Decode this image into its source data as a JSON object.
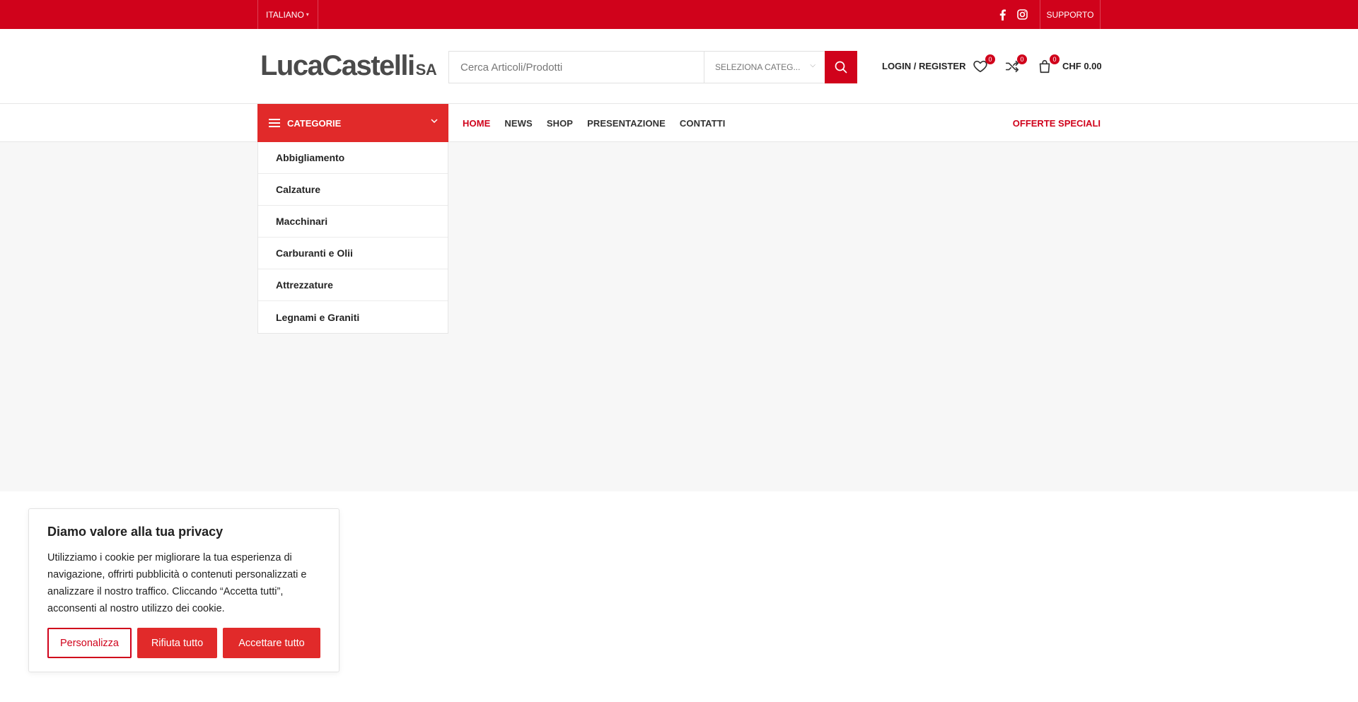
{
  "topbar": {
    "language": "ITALIANO",
    "support": "SUPPORTO",
    "social": [
      "facebook-icon",
      "instagram-icon"
    ]
  },
  "header": {
    "logo_main": "LucaCastelli",
    "logo_suffix": "SA",
    "search_placeholder": "Cerca Articoli/Prodotti",
    "search_category": "SELEZIONA CATEG...",
    "login": "LOGIN / REGISTER",
    "wishlist_count": "0",
    "compare_count": "0",
    "cart_count": "0",
    "cart_total": "CHF 0.00"
  },
  "nav": {
    "categories_label": "CATEGORIE",
    "items": [
      "HOME",
      "NEWS",
      "SHOP",
      "PRESENTAZIONE",
      "CONTATTI"
    ],
    "offers": "OFFERTE SPECIALI"
  },
  "categories": [
    "Abbigliamento",
    "Calzature",
    "Macchinari",
    "Carburanti e Olii",
    "Attrezzature",
    "Legnami e Graniti"
  ],
  "cookie": {
    "title": "Diamo valore alla tua privacy",
    "text": "Utilizziamo i cookie per migliorare la tua esperienza di navigazione, offrirti pubblicità o contenuti personalizzati e analizzare il nostro traffico. Cliccando “Accetta tutti”, acconsenti al nostro utilizzo dei cookie.",
    "customize": "Personalizza",
    "reject": "Rifiuta tutto",
    "accept": "Accettare tutto"
  },
  "colors": {
    "brand_red": "#d0021b",
    "category_red": "#e12a2a"
  }
}
